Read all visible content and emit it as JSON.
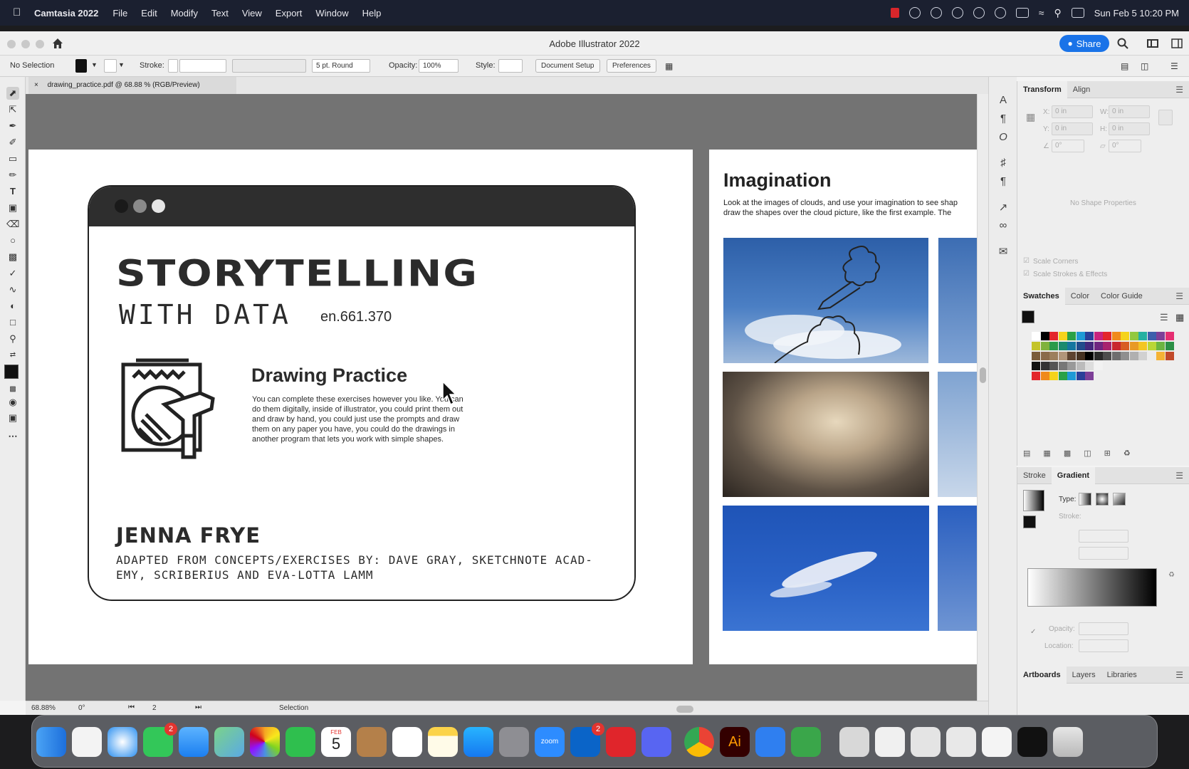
{
  "menubar": {
    "app": "Camtasia 2022",
    "items": [
      "File",
      "Edit",
      "Modify",
      "Text",
      "View",
      "Export",
      "Window",
      "Help"
    ],
    "datetime": "Sun Feb 5  10:20 PM"
  },
  "window": {
    "title": "Adobe Illustrator 2022",
    "share_label": "Share"
  },
  "control": {
    "selection": "No Selection",
    "stroke_label": "Stroke:",
    "brush": "5 pt. Round",
    "opacity_label": "Opacity:",
    "opacity_value": "100%",
    "style_label": "Style:",
    "document_setup": "Document Setup",
    "preferences": "Preferences"
  },
  "doc_tab": {
    "close": "×",
    "label": "drawing_practice.pdf @ 68.88 % (RGB/Preview)"
  },
  "artboard1": {
    "title": "storytelling",
    "subtitle": "with data",
    "code": "en.661.370",
    "section_title": "Drawing Practice",
    "body": "You can complete these exercises however you like. You can do them digitally, inside of illustrator, you could print them out and draw by hand, you could just use the prompts and draw them on any paper you have, you could do the drawings in another program that lets you work with simple shapes.",
    "author": "Jenna Frye",
    "credits": "adapted from concepts/exercises by: Dave Gray, sketchnote acad-emy, scriberius and Eva-Lotta Lamm"
  },
  "artboard2": {
    "title": "Imagination",
    "body_line1": "Look at the images of clouds, and use your imagination to see shap",
    "body_line2": "draw the shapes over the cloud picture, like the first example. The"
  },
  "status": {
    "zoom": "68.88%",
    "rotation": "0°",
    "artboard_num": "2",
    "tool": "Selection"
  },
  "panels": {
    "transform_tabs": [
      "Transform",
      "Align"
    ],
    "x_label": "X:",
    "x_value": "0 in",
    "y_label": "Y:",
    "y_value": "0 in",
    "w_label": "W:",
    "w_value": "0 in",
    "h_label": "H:",
    "h_value": "0 in",
    "angle_value": "0°",
    "shear_value": "0°",
    "no_shape": "No Shape Properties",
    "scale_corners": "Scale Corners",
    "scale_strokes": "Scale Strokes & Effects",
    "swatch_tabs": [
      "Swatches",
      "Color",
      "Color Guide"
    ],
    "stroke_tabs": [
      "Stroke",
      "Gradient"
    ],
    "type_label": "Type:",
    "stroke_label": "Stroke:",
    "opacity_label": "Opacity:",
    "location_label": "Location:",
    "bottom_tabs": [
      "Artboards",
      "Layers",
      "Libraries"
    ]
  },
  "dock": {
    "calendar_month": "FEB",
    "calendar_day": "5",
    "zoom_label": "zoom",
    "messages_badge": "2",
    "outlook_badge": "2"
  },
  "colors": {
    "accent": "#1a73e8",
    "canvas": "#737373",
    "browser_bar": "#2e2e2e",
    "dot_dark": "#1a1a1a",
    "dot_gray": "#8a8a8a",
    "dot_light": "#e6e6e6"
  }
}
